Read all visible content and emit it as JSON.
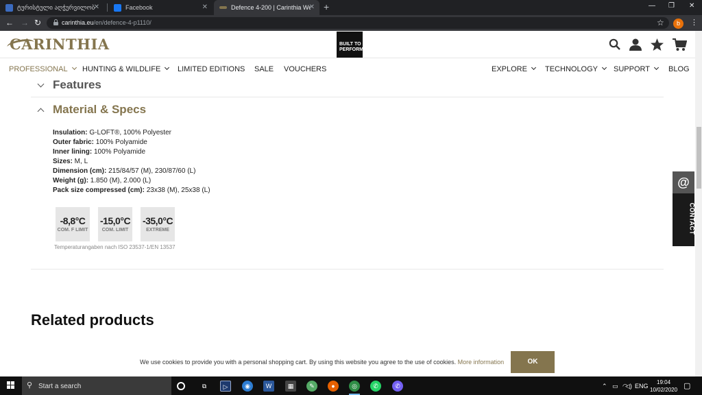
{
  "browser": {
    "tabs": [
      {
        "title": "ტურისტული აღჭურვილობ",
        "favicon_color": "#3b6bbf"
      },
      {
        "title": "Facebook",
        "favicon_color": "#1877f2"
      },
      {
        "title": "Defence 4-200 | Carinthia Websh",
        "favicon_color": "#84754e"
      }
    ],
    "new_tab": "+",
    "url_domain": "carinthia.eu",
    "url_path": "/en/defence-4-p1110/",
    "profile_initial": "b"
  },
  "site": {
    "logo": "CARINTHIA",
    "badge": [
      "BUILT TO",
      "PERFORM"
    ],
    "nav_left": [
      "PROFESSIONAL",
      "HUNTING & WILDLIFE",
      "LIMITED EDITIONS",
      "SALE",
      "VOUCHERS"
    ],
    "nav_right": [
      "EXPLORE",
      "TECHNOLOGY",
      "SUPPORT",
      "BLOG"
    ]
  },
  "features": {
    "title": "Features"
  },
  "specs": {
    "title": "Material & Specs",
    "rows": [
      {
        "label": "Insulation:",
        "value": " G-LOFT®, 100% Polyester"
      },
      {
        "label": "Outer fabric:",
        "value": " 100% Polyamide"
      },
      {
        "label": "Inner lining:",
        "value": " 100% Polyamide"
      },
      {
        "label": "Sizes:",
        "value": " M, L"
      },
      {
        "label": "Dimension (cm):",
        "value": " 215/84/57 (M), 230/87/60 (L)"
      },
      {
        "label": "Weight (g):",
        "value": " 1.850 (M), 2.000 (L)"
      },
      {
        "label": "Pack size compressed (cm):",
        "value": " 23x38 (M), 25x38 (L)"
      }
    ],
    "temps": [
      {
        "value": "-8,8°C",
        "label": "COM. F LIMIT"
      },
      {
        "value": "-15,0°C",
        "label": "COM. LIMIT"
      },
      {
        "value": "-35,0°C",
        "label": "EXTREME"
      }
    ],
    "iso_note": "Temperaturangaben nach ISO 23537-1/EN 13537"
  },
  "related": {
    "title": "Related products"
  },
  "contact": {
    "at": "@",
    "label": "CONTACT"
  },
  "cookie": {
    "text": "We use cookies to provide you with a personal shopping cart. By using this website you agree to the use of cookies.",
    "more": "More information",
    "ok": "OK"
  },
  "taskbar": {
    "search_placeholder": "Start a search",
    "lang": "ENG",
    "time": "19:04",
    "date": "10/02/2020"
  },
  "colors": {
    "accent": "#84754e",
    "chrome_dark": "#202124"
  }
}
